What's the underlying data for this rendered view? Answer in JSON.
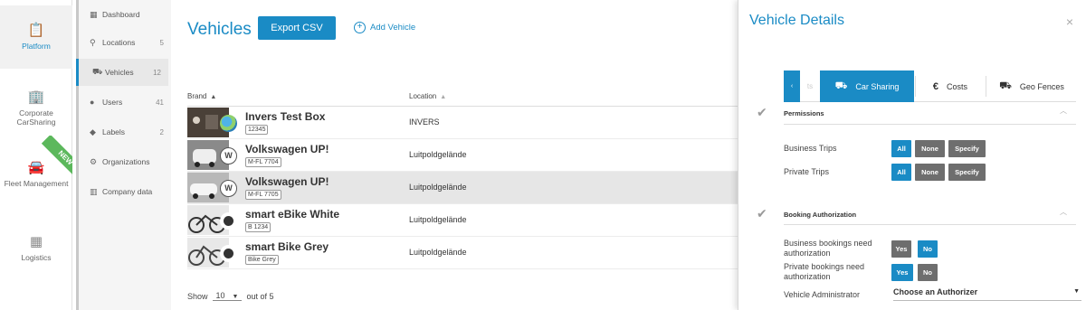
{
  "rail": {
    "items": [
      {
        "label": "Platform",
        "icon": "clipboard-icon",
        "glyph": "📋"
      },
      {
        "label": "Corporate CarSharing",
        "icon": "building-icon",
        "glyph": "🏢"
      },
      {
        "label": "Fleet Management",
        "icon": "car-icon",
        "glyph": "🚘"
      },
      {
        "label": "Logistics",
        "icon": "warehouse-icon",
        "glyph": "▦"
      }
    ],
    "new_badge": "NEW"
  },
  "subnav": {
    "items": [
      {
        "label": "Dashboard",
        "glyph": "▦",
        "count": ""
      },
      {
        "label": "Locations",
        "glyph": "⚲",
        "count": "5"
      },
      {
        "label": "Vehicles",
        "glyph": "⛟",
        "count": "12"
      },
      {
        "label": "Users",
        "glyph": "●",
        "count": "41"
      },
      {
        "label": "Labels",
        "glyph": "◆",
        "count": "2"
      },
      {
        "label": "Organizations",
        "glyph": "⚙",
        "count": ""
      },
      {
        "label": "Company data",
        "glyph": "▥",
        "count": ""
      }
    ]
  },
  "main": {
    "title": "Vehicles",
    "export_label": "Export CSV",
    "add_label": "Add Vehicle",
    "columns": {
      "brand": "Brand",
      "location": "Location"
    },
    "rows": [
      {
        "name": "Invers Test Box",
        "plate": "12345",
        "location": "INVERS",
        "logo": "invers"
      },
      {
        "name": "Volkswagen UP!",
        "plate": "M-FL 7704",
        "location": "Luitpoldgelände",
        "logo": "vw"
      },
      {
        "name": "Volkswagen UP!",
        "plate": "M-FL 7705",
        "location": "Luitpoldgelände",
        "logo": "vw"
      },
      {
        "name": "smart eBike White",
        "plate": "B 1234",
        "location": "Luitpoldgelände",
        "logo": "smart"
      },
      {
        "name": "smart Bike Grey",
        "plate": "Bike Grey",
        "location": "Luitpoldgelände",
        "logo": "smart"
      }
    ],
    "footer": {
      "show": "Show",
      "page_size": "10",
      "out_of": "out of 5"
    }
  },
  "panel": {
    "title": "Vehicle Details",
    "close": "×",
    "tabs": {
      "prev": "‹",
      "prev_ghost": "ts",
      "car_sharing": "Car Sharing",
      "costs": "Costs",
      "geo_fences": "Geo Fences"
    },
    "permissions": {
      "title": "Permissions",
      "business_trips": "Business Trips",
      "private_trips": "Private Trips",
      "all": "All",
      "none": "None",
      "specify": "Specify"
    },
    "booking": {
      "title": "Booking Authorization",
      "business_label": "Business bookings need authorization",
      "private_label": "Private bookings need authorization",
      "yes": "Yes",
      "no": "No",
      "admin_label": "Vehicle Administrator",
      "admin_value": "Choose an Authorizer"
    }
  },
  "colors": {
    "accent": "#1a8bc5",
    "button_off": "#6e6e6e",
    "new_badge": "#5cb85c"
  }
}
